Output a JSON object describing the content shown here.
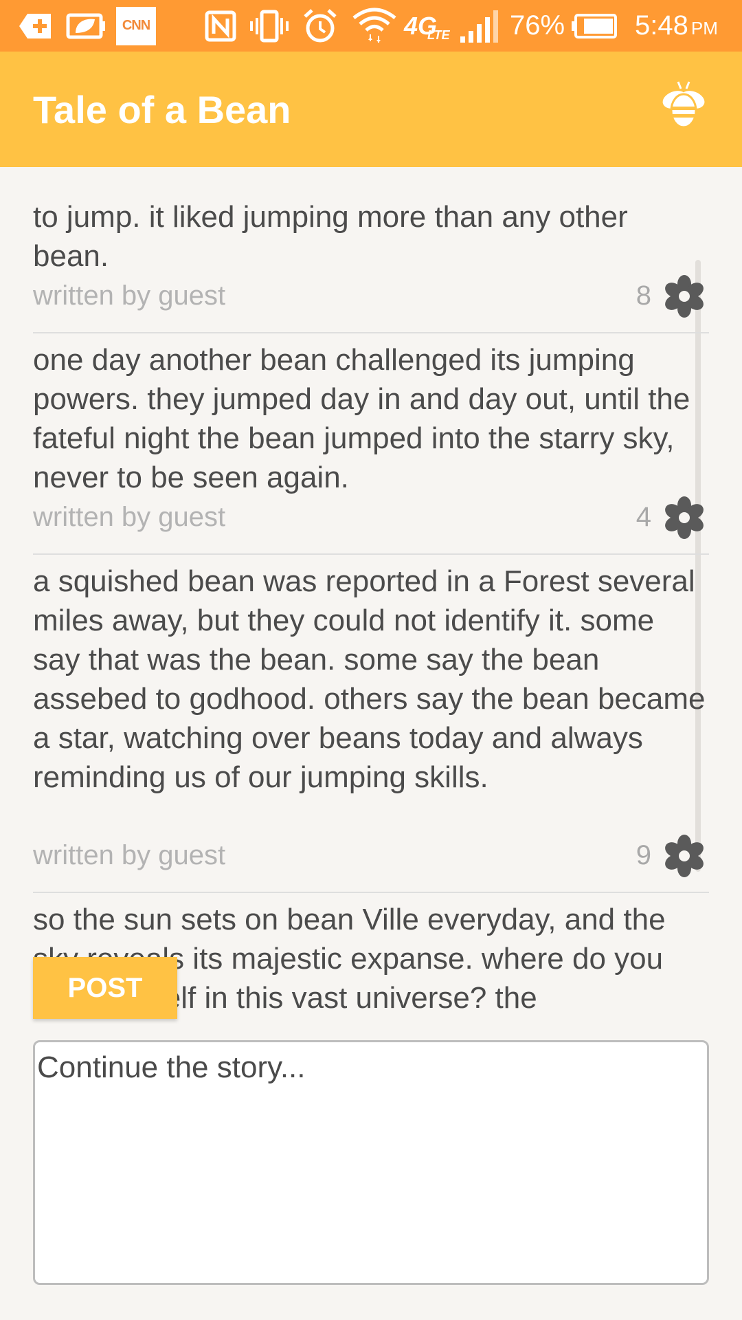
{
  "status_bar": {
    "icons": [
      "plus-notification-icon",
      "battery-saver-icon",
      "cnn-icon",
      "nfc-icon",
      "vibrate-icon",
      "alarm-icon",
      "wifi-icon",
      "lte-icon",
      "signal-icon",
      "battery-icon"
    ],
    "cnn_label": "CNN",
    "network_label": "4G",
    "network_sub": "LTE",
    "battery_percent": "76%",
    "time": "5:48",
    "ampm": "PM",
    "background_color": "#ff9a33"
  },
  "app_bar": {
    "title": "Tale of a Bean",
    "action_icon": "bee-icon",
    "background_color": "#ffc244"
  },
  "story": {
    "entries": [
      {
        "text": "to jump. it liked jumping more than any other bean.",
        "author": "written by guest",
        "count": "8"
      },
      {
        "text": "one day another bean challenged its jumping powers. they jumped day in and day out, until the fateful night the bean jumped into the starry sky, never to be seen again.",
        "author": "written by guest",
        "count": "4"
      },
      {
        "text": "a squished bean was reported in a Forest several miles away, but they could not identify it. some say that was the bean. some say the bean assebed to godhood. others say the bean became a star, watching over beans today and always reminding us of our jumping skills.",
        "author": "written by guest",
        "count": "9"
      },
      {
        "text": "so the sun sets on bean Ville everyday, and the sky reveals its majestic expanse. where do you find yourself in this vast universe? the"
      }
    ],
    "vote_icon": "flower-icon"
  },
  "post_button": {
    "label": "POST"
  },
  "input": {
    "placeholder": "Continue the story..."
  },
  "accent_color": "#ffc244"
}
